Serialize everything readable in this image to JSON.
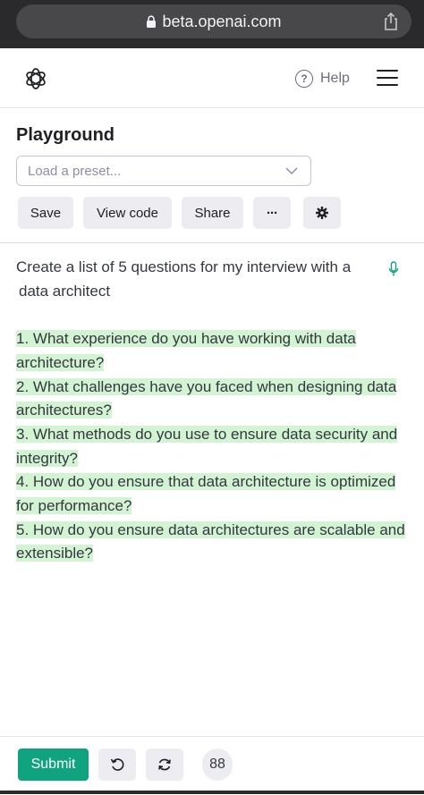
{
  "browser": {
    "url": "beta.openai.com"
  },
  "header": {
    "help_label": "Help"
  },
  "playground": {
    "title": "Playground",
    "preset_placeholder": "Load a preset...",
    "buttons": {
      "save": "Save",
      "view_code": "View code",
      "share": "Share",
      "more": "···"
    }
  },
  "editor": {
    "prompt_line1": "Create a list of  5 questions for my interview with a",
    "prompt_line2": "data architect",
    "answers": [
      "1. What experience do you have working with data architecture?",
      "2. What challenges have you faced when designing data architectures?",
      "3. What methods do you use to ensure data security and integrity?",
      "4. How do you ensure that data architecture is optimized for performance?",
      "5. How do you ensure data architectures are scalable and extensible?"
    ],
    "highlight_color": "#d2f4d3"
  },
  "footer": {
    "submit_label": "Submit",
    "token_count": "88"
  },
  "colors": {
    "accent": "#10a37f",
    "button_bg": "#ececf1"
  }
}
